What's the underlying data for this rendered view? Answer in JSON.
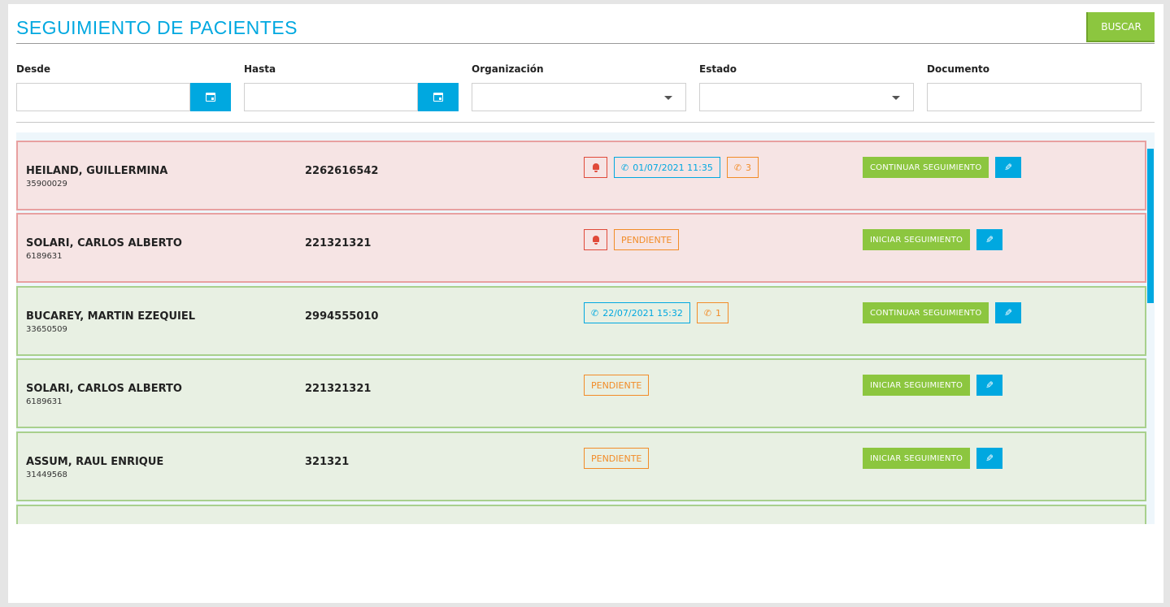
{
  "page": {
    "title": "SEGUIMIENTO DE PACIENTES",
    "search_button": "BUSCAR"
  },
  "filters": {
    "desde": {
      "label": "Desde",
      "value": ""
    },
    "hasta": {
      "label": "Hasta",
      "value": ""
    },
    "organizacion": {
      "label": "Organización",
      "value": ""
    },
    "estado": {
      "label": "Estado",
      "value": ""
    },
    "documento": {
      "label": "Documento",
      "value": ""
    }
  },
  "icons": {
    "calendar": "calendar-icon",
    "bell": "bell-icon",
    "phone": "phone-icon",
    "edit": "pencil-icon",
    "caret": "chevron-down-icon"
  },
  "colors": {
    "accent": "#00a8e0",
    "success": "#8cc63f",
    "alert_row_bg": "#f6e4e4",
    "ok_row_bg": "#e8f0e3",
    "pending": "#f28c28",
    "danger": "#e04a3a"
  },
  "rows": [
    {
      "name": "HEILAND, GUILLERMINA",
      "document": "35900029",
      "phone": "2262616542",
      "status": "alert",
      "bell": true,
      "last_call": "01/07/2021 11:35",
      "call_count": "3",
      "pending": "",
      "action": "CONTINUAR SEGUIMIENTO"
    },
    {
      "name": "SOLARI, CARLOS ALBERTO",
      "document": "6189631",
      "phone": "221321321",
      "status": "alert",
      "bell": true,
      "last_call": "",
      "call_count": "",
      "pending": "PENDIENTE",
      "action": "INICIAR SEGUIMIENTO"
    },
    {
      "name": "BUCAREY, MARTIN EZEQUIEL",
      "document": "33650509",
      "phone": "2994555010",
      "status": "ok",
      "bell": false,
      "last_call": "22/07/2021 15:32",
      "call_count": "1",
      "pending": "",
      "action": "CONTINUAR SEGUIMIENTO"
    },
    {
      "name": "SOLARI, CARLOS ALBERTO",
      "document": "6189631",
      "phone": "221321321",
      "status": "ok",
      "bell": false,
      "last_call": "",
      "call_count": "",
      "pending": "PENDIENTE",
      "action": "INICIAR SEGUIMIENTO"
    },
    {
      "name": "ASSUM, RAUL ENRIQUE",
      "document": "31449568",
      "phone": "321321",
      "status": "ok",
      "bell": false,
      "last_call": "",
      "call_count": "",
      "pending": "PENDIENTE",
      "action": "INICIAR SEGUIMIENTO"
    },
    {
      "name": "",
      "document": "",
      "phone": "",
      "status": "ok",
      "bell": false,
      "last_call": "",
      "call_count": "",
      "pending": "",
      "action": ""
    }
  ]
}
